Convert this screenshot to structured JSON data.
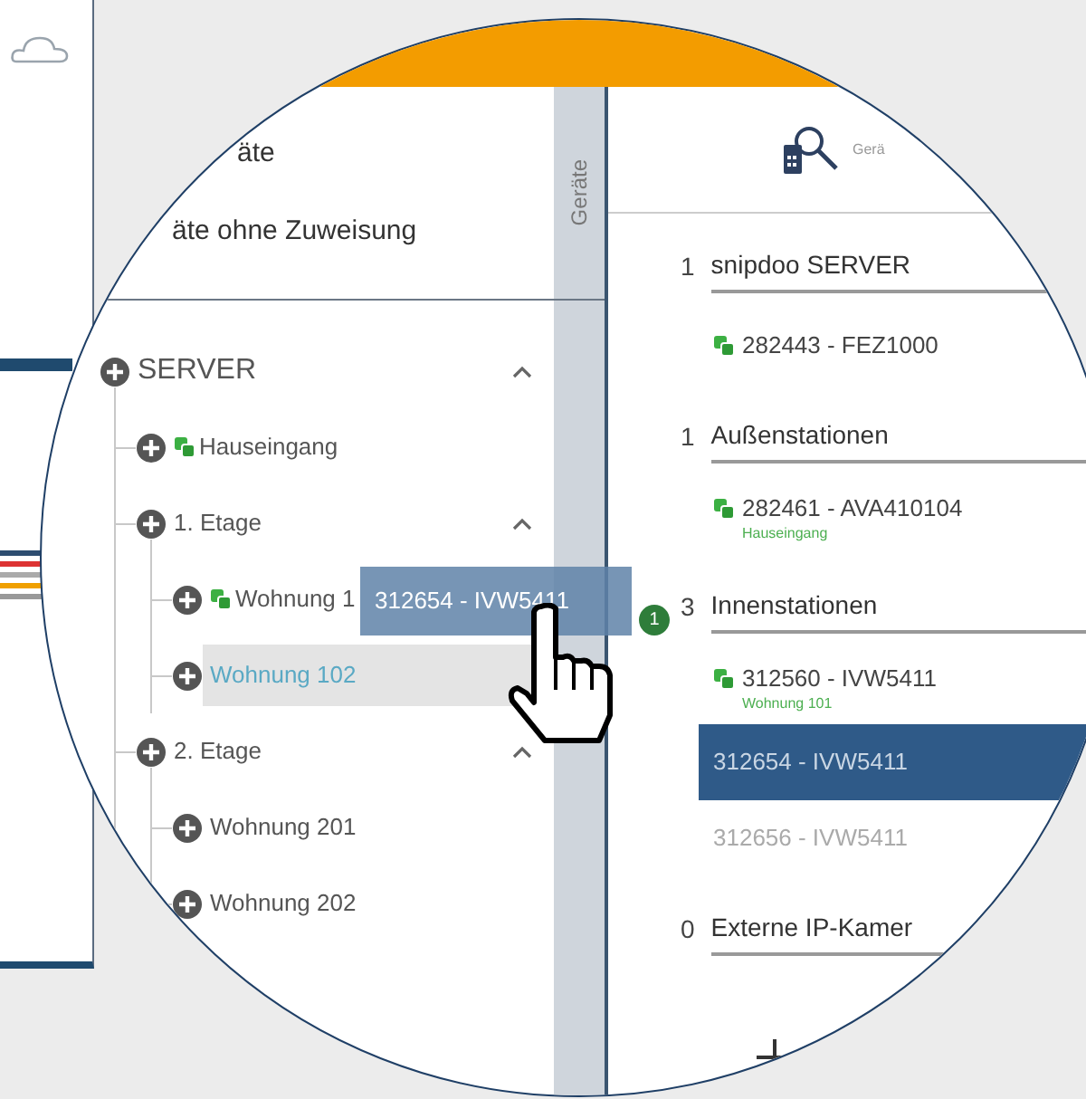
{
  "top_links": [
    "äte",
    "äte ohne Zuweisung"
  ],
  "side_tab": "Geräte",
  "tree": [
    {
      "label": "SERVER",
      "expanded": true,
      "linked": false,
      "selected": false,
      "children": [
        {
          "label": "Hauseingang",
          "linked": true,
          "selected": false
        },
        {
          "label": "1. Etage",
          "expanded": true,
          "linked": false,
          "selected": false,
          "children": [
            {
              "label": "Wohnung 1",
              "linked": true,
              "selected": false
            },
            {
              "label": "Wohnung 102",
              "linked": false,
              "selected": true
            }
          ]
        },
        {
          "label": "2. Etage",
          "expanded": true,
          "linked": false,
          "selected": false,
          "children": [
            {
              "label": "Wohnung 201",
              "linked": false,
              "selected": false
            },
            {
              "label": "Wohnung 202",
              "linked": false,
              "selected": false
            }
          ]
        }
      ]
    }
  ],
  "devices_header": "Gerä",
  "groups": [
    {
      "count": "1",
      "title": "snipdoo SERVER",
      "items": [
        {
          "label": "282443 - FEZ1000",
          "linked": true,
          "selected": false
        }
      ]
    },
    {
      "count": "1",
      "title": "Außenstationen",
      "items": [
        {
          "label": "282461 - AVA410104",
          "sub": "Hauseingang",
          "linked": true,
          "selected": false
        }
      ]
    },
    {
      "count": "3",
      "title": "Innenstationen",
      "items": [
        {
          "label": "312560 - IVW5411",
          "sub": "Wohnung 101",
          "linked": true,
          "selected": false
        },
        {
          "label": "312654 - IVW5411",
          "linked": false,
          "selected": true
        },
        {
          "label": "312656 - IVW5411",
          "linked": false,
          "selected": false
        }
      ]
    },
    {
      "count": "0",
      "title": "Externe IP-Kamer"
    }
  ],
  "drag": {
    "label": "312654 - IVW5411",
    "badge": "1"
  }
}
